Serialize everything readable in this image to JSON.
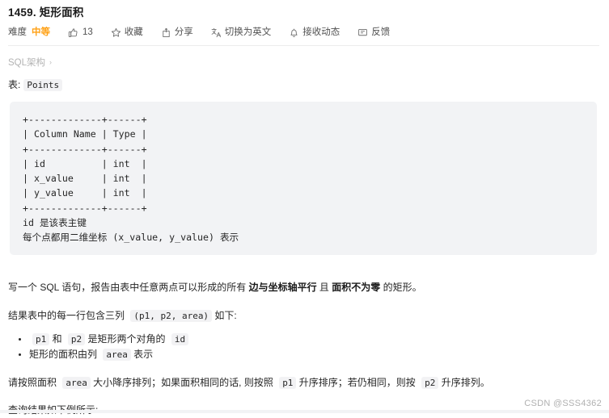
{
  "header": {
    "title": "1459. 矩形面积",
    "toolbar": {
      "difficulty_label": "难度",
      "difficulty_value": "中等",
      "like_count": "13",
      "favorite_label": "收藏",
      "share_label": "分享",
      "translate_label": "切换为英文",
      "subscribe_label": "接收动态",
      "feedback_label": "反馈"
    }
  },
  "schema": {
    "link_label": "SQL架构",
    "caret": "›",
    "table_prefix": "表:",
    "table_name": "Points"
  },
  "code_block": {
    "text": "+-------------+------+\n| Column Name | Type |\n+-------------+------+\n| id          | int  |\n| x_value     | int  |\n| y_value     | int  |\n+-------------+------+\nid 是该表主键\n每个点都用二维坐标 (x_value, y_value) 表示"
  },
  "content": {
    "p1_before": "写一个 SQL 语句，报告由表中任意两点可以形成的所有 ",
    "p1_bold1": "边与坐标轴平行",
    "p1_middle": " 且 ",
    "p1_bold2": "面积不为零",
    "p1_after": " 的矩形。",
    "p2_before": "结果表中的每一行包含三列 ",
    "p2_code": "(p1, p2, area)",
    "p2_after": " 如下:",
    "bullets": [
      {
        "code1": "p1",
        "mid1": " 和 ",
        "code2": "p2",
        "mid2": " 是矩形两个对角的 ",
        "code3": "id"
      },
      {
        "before": "矩形的面积由列 ",
        "code": "area",
        "after": " 表示"
      }
    ],
    "p3_before": "请按照面积 ",
    "p3_code1": "area",
    "p3_mid1": " 大小降序排列；如果面积相同的话, 则按照 ",
    "p3_code2": "p1",
    "p3_mid2": " 升序排序；若仍相同，则按 ",
    "p3_code3": "p2",
    "p3_after": " 升序排列。",
    "p4": "查询结果如下例所示:"
  },
  "watermark": "CSDN @SSS4362",
  "colors": {
    "difficulty_medium": "#ffa116",
    "code_block_bg": "#f2f3f5",
    "inline_code_bg": "#f2f2f4",
    "text": "#262626",
    "muted": "#b3b3b3"
  }
}
